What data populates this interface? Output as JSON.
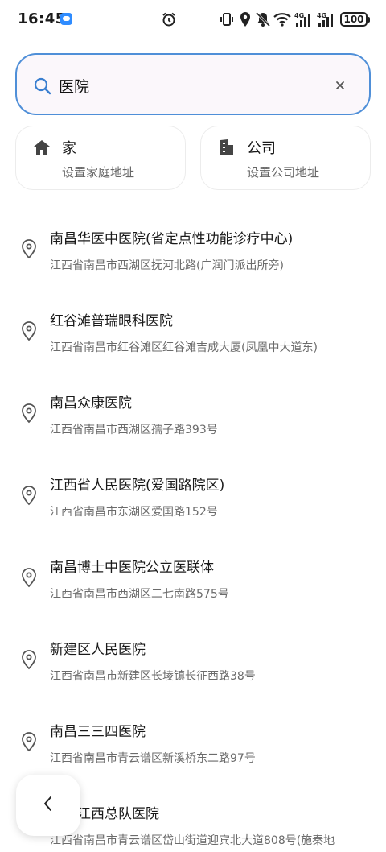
{
  "status_bar": {
    "time": "16:45",
    "battery": "100"
  },
  "search": {
    "value": "医院",
    "placeholder": ""
  },
  "shortcuts": [
    {
      "title": "家",
      "subtitle": "设置家庭地址",
      "icon": "home-icon"
    },
    {
      "title": "公司",
      "subtitle": "设置公司地址",
      "icon": "building-icon"
    }
  ],
  "results": [
    {
      "name": "南昌华医中医院(省定点性功能诊疗中心)",
      "address": "江西省南昌市西湖区抚河北路(广润门派出所旁)"
    },
    {
      "name": "红谷滩普瑞眼科医院",
      "address": "江西省南昌市红谷滩区红谷滩吉成大厦(凤凰中大道东)"
    },
    {
      "name": "南昌众康医院",
      "address": "江西省南昌市西湖区孺子路393号"
    },
    {
      "name": "江西省人民医院(爱国路院区)",
      "address": "江西省南昌市东湖区爱国路152号"
    },
    {
      "name": "南昌博士中医院公立医联体",
      "address": "江西省南昌市西湖区二七南路575号"
    },
    {
      "name": "新建区人民医院",
      "address": "江西省南昌市新建区长堎镇长征西路38号"
    },
    {
      "name": "南昌三三四医院",
      "address": "江西省南昌市青云谱区新溪桥东二路97号"
    },
    {
      "name": "武警江西总队医院",
      "address": "江西省南昌市青云谱区岱山街道迎宾北大道808号(施秦地"
    }
  ]
}
